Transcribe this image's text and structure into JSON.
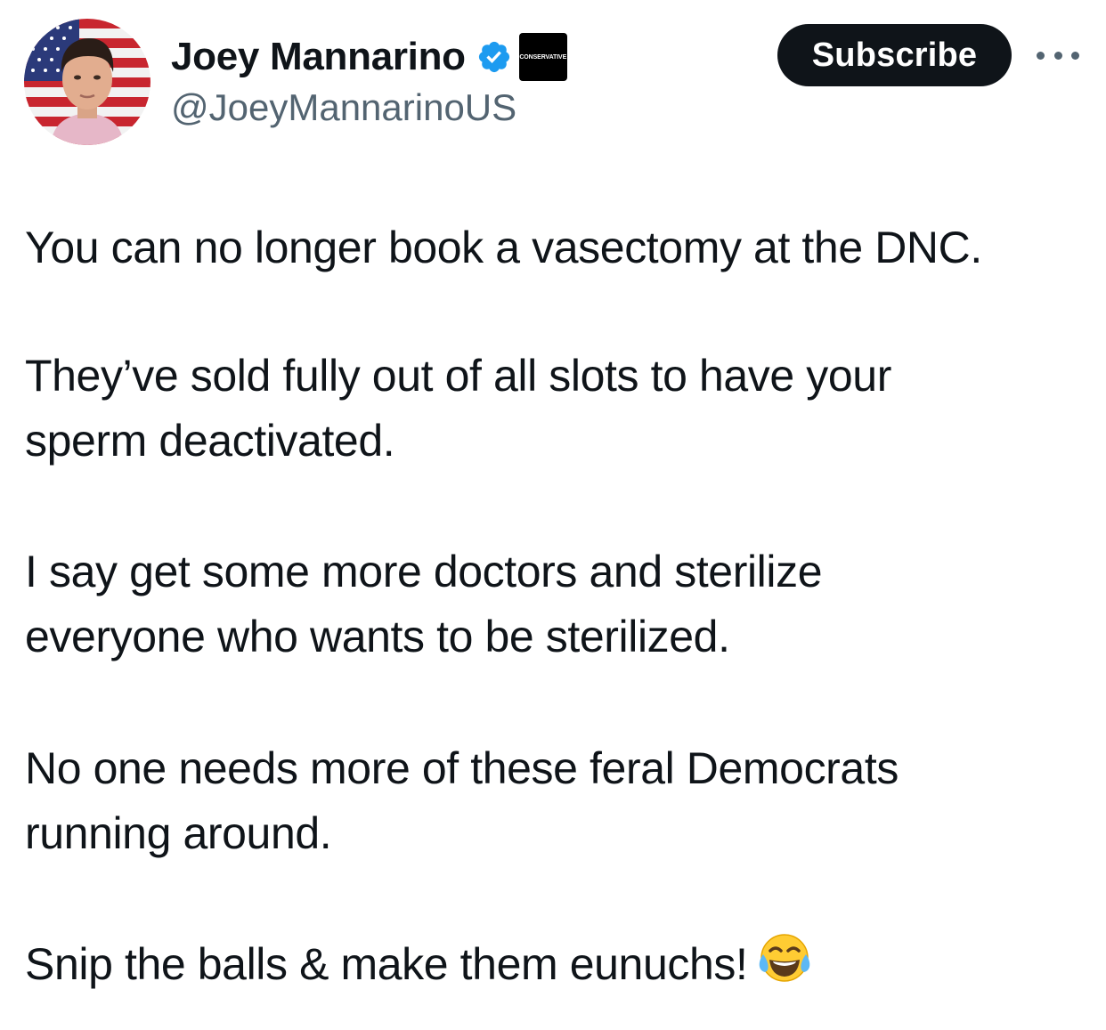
{
  "author": {
    "display_name": "Joey Mannarino",
    "handle": "@JoeyMannarinoUS",
    "verified_badge_icon": "verified-check-icon",
    "affiliation_badge_text": "CONSERVATIVE",
    "avatar_icon": "avatar-with-flag"
  },
  "actions": {
    "subscribe_label": "Subscribe",
    "more_icon": "more-dots-icon"
  },
  "tweet": {
    "lines": [
      "You can no longer book a vasectomy at the DNC.",
      "They’ve sold fully out of all slots to have your",
      "sperm deactivated.",
      "I say get some more doctors and sterilize",
      "everyone who wants to be sterilized.",
      "No one needs more of these feral Democrats",
      "running around.",
      "Snip the balls & make them eunuchs!"
    ],
    "emoji_icon": "face-with-tears-of-joy-icon"
  },
  "colors": {
    "text": "#0f1419",
    "secondary": "#536471",
    "verified_blue": "#1d9bf0",
    "button_bg": "#0f1419"
  }
}
